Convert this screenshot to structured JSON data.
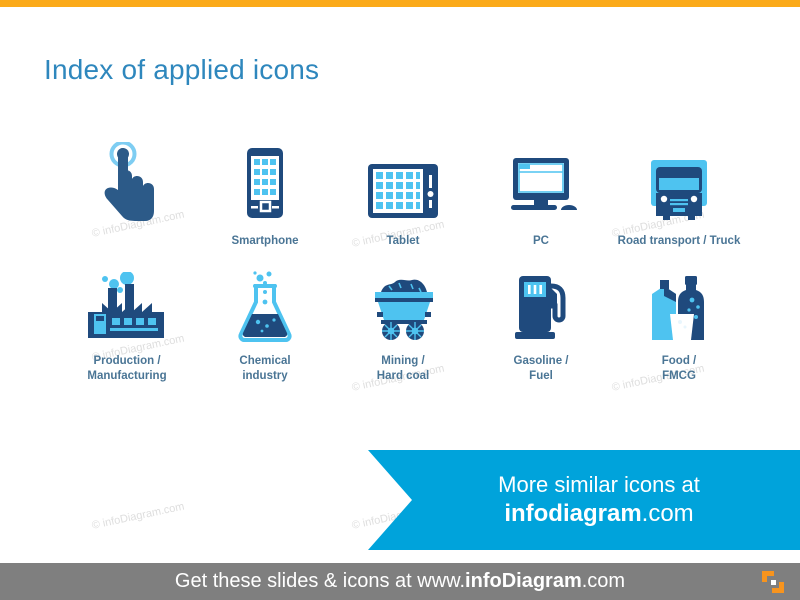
{
  "slide": {
    "title": "Index of applied icons",
    "accent_top_color": "#fbaa19",
    "title_color": "#2e87bd",
    "icon_dark_color": "#1f4a7d",
    "icon_light_color": "#4ec3f0",
    "label_color": "#4a7595"
  },
  "icons": [
    {
      "name": "touch-hand-icon",
      "label": ""
    },
    {
      "name": "smartphone-icon",
      "label": "Smartphone"
    },
    {
      "name": "tablet-icon",
      "label": "Tablet"
    },
    {
      "name": "pc-icon",
      "label": "PC"
    },
    {
      "name": "truck-icon",
      "label": "Road transport / Truck"
    },
    {
      "name": "factory-icon",
      "label": "Production / Manufacturing"
    },
    {
      "name": "flask-icon",
      "label": "Chemical industry"
    },
    {
      "name": "mining-cart-icon",
      "label": "Mining / Hard coal"
    },
    {
      "name": "fuel-pump-icon",
      "label": "Gasoline / Fuel"
    },
    {
      "name": "food-bottles-icon",
      "label": "Food / FMCG"
    }
  ],
  "labels": {
    "smartphone": "Smartphone",
    "tablet": "Tablet",
    "pc": "PC",
    "truck": "Road transport / Truck",
    "production_l1": "Production /",
    "production_l2": "Manufacturing",
    "chemical_l1": "Chemical",
    "chemical_l2": "industry",
    "mining_l1": "Mining /",
    "mining_l2": "Hard coal",
    "gasoline_l1": "Gasoline /",
    "gasoline_l2": "Fuel",
    "food_l1": "Food /",
    "food_l2": "FMCG"
  },
  "cta": {
    "line1": "More similar icons at",
    "brand": "infodiagram",
    "tld": ".com",
    "background_color": "#00a3db"
  },
  "footer": {
    "prefix": "Get these slides & icons at www.",
    "brand": "infoDiagram",
    "tld": ".com",
    "background_color": "#7f7f7f",
    "logo_color": "#f7941e"
  },
  "watermark": {
    "text": "© infoDiagram.com"
  }
}
